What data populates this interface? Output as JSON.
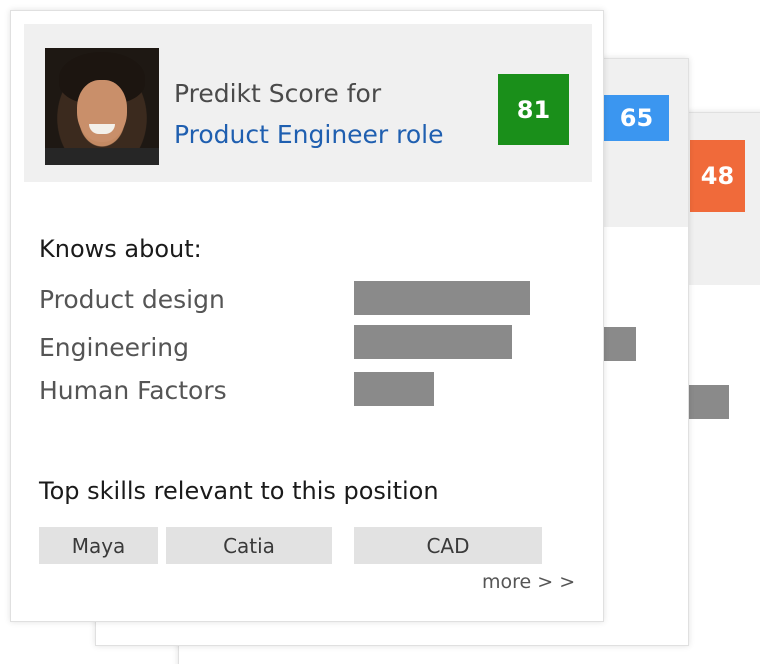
{
  "cards": [
    {
      "score": "81",
      "score_color": "#1a8f1a",
      "title_prefix": "Predikt Score for",
      "role_link": "Product Engineer role",
      "knows_about_title": "Knows about:",
      "knowledge": [
        {
          "label": "Product design",
          "level": 0.88
        },
        {
          "label": "Engineering",
          "level": 0.79
        },
        {
          "label": "Human Factors",
          "level": 0.4
        }
      ],
      "top_skills_title": "Top skills relevant to this position",
      "skill_tags": [
        "Maya",
        "Catia",
        "CAD"
      ],
      "more_link": "more > >"
    },
    {
      "score": "65",
      "score_color": "#3b96f0"
    },
    {
      "score": "48",
      "score_color": "#f06a3a"
    }
  ],
  "bar_color": "#8a8a8a",
  "header_background": "#f0f0f0"
}
